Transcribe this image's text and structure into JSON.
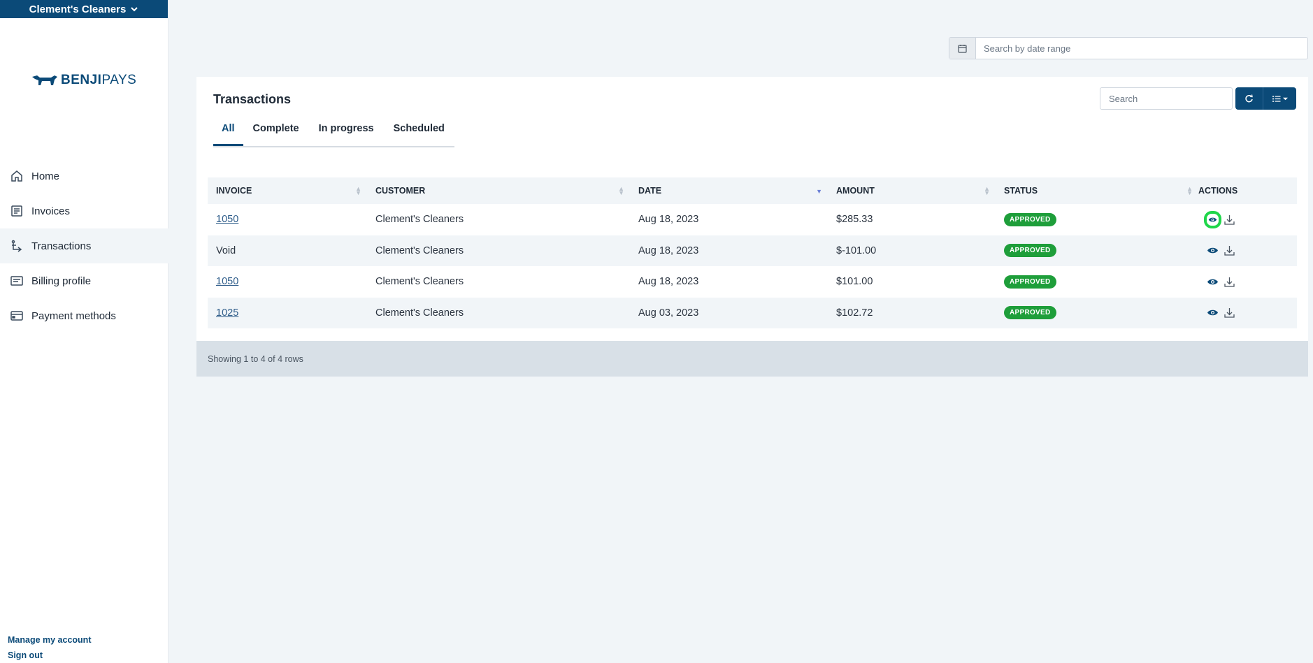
{
  "org": {
    "name": "Clement's Cleaners"
  },
  "logo": {
    "text_bold": "BENJI",
    "text_light": "PAYS"
  },
  "nav": [
    {
      "label": "Home",
      "icon": "home-icon"
    },
    {
      "label": "Invoices",
      "icon": "invoice-icon"
    },
    {
      "label": "Transactions",
      "icon": "transactions-icon",
      "active": true
    },
    {
      "label": "Billing profile",
      "icon": "billing-icon"
    },
    {
      "label": "Payment methods",
      "icon": "card-icon"
    }
  ],
  "account": {
    "manage": "Manage my account",
    "signout": "Sign out"
  },
  "date_range": {
    "placeholder": "Search by date range"
  },
  "card": {
    "title": "Transactions",
    "tabs": [
      "All",
      "Complete",
      "In progress",
      "Scheduled"
    ],
    "active_tab": "All",
    "search_placeholder": "Search"
  },
  "table": {
    "headers": [
      "INVOICE",
      "CUSTOMER",
      "DATE",
      "AMOUNT",
      "STATUS",
      "ACTIONS"
    ],
    "rows": [
      {
        "invoice": "1050",
        "invoice_link": true,
        "customer": "Clement's Cleaners",
        "date": "Aug 18, 2023",
        "amount": "$285.33",
        "status": "APPROVED"
      },
      {
        "invoice": "Void",
        "invoice_link": false,
        "customer": "Clement's Cleaners",
        "date": "Aug 18, 2023",
        "amount": "$-101.00",
        "status": "APPROVED"
      },
      {
        "invoice": "1050",
        "invoice_link": true,
        "customer": "Clement's Cleaners",
        "date": "Aug 18, 2023",
        "amount": "$101.00",
        "status": "APPROVED"
      },
      {
        "invoice": "1025",
        "invoice_link": true,
        "customer": "Clement's Cleaners",
        "date": "Aug 03, 2023",
        "amount": "$102.72",
        "status": "APPROVED"
      }
    ],
    "footer": "Showing 1 to 4 of 4 rows"
  },
  "colors": {
    "brand": "#0b4a78",
    "status_approved": "#1e9e3a",
    "highlight": "#1fd64a"
  }
}
